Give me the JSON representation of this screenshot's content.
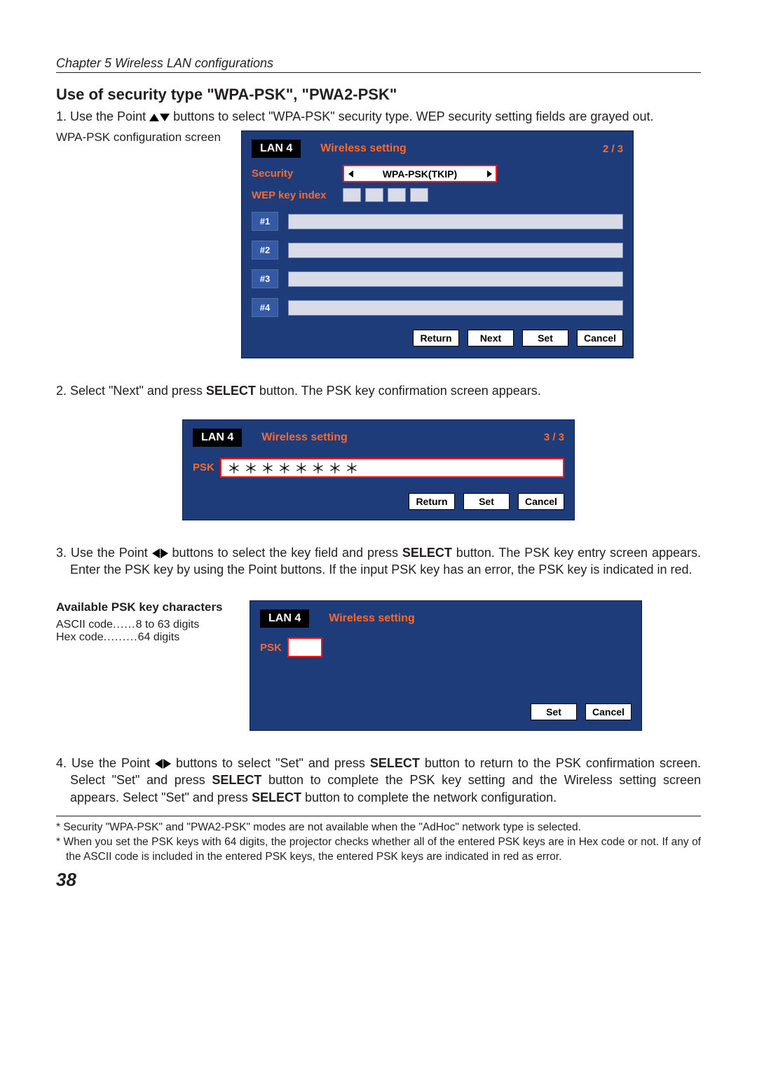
{
  "chapter": "Chapter 5 Wireless LAN configurations",
  "section_title": "Use of security type \"WPA-PSK\", \"PWA2-PSK\"",
  "step1_a": "1. Use the Point ",
  "step1_b": " buttons to select \"WPA-PSK\" security type. WEP security setting fields are grayed out.",
  "caption1": "WPA-PSK configuration screen",
  "screen1": {
    "lan": "LAN 4",
    "title": "Wireless setting",
    "page": "2 / 3",
    "security_label": "Security",
    "security_value": "WPA-PSK(TKIP)",
    "wep_label": "WEP key index",
    "keys": [
      "#1",
      "#2",
      "#3",
      "#4"
    ],
    "btn_return": "Return",
    "btn_next": "Next",
    "btn_set": "Set",
    "btn_cancel": "Cancel"
  },
  "step2_a": "2. Select \"Next\" and press ",
  "step2_select": "SELECT",
  "step2_b": " button. The PSK key confirmation screen appears.",
  "screen2": {
    "lan": "LAN 4",
    "title": "Wireless setting",
    "page": "3 / 3",
    "psk_label": "PSK",
    "psk_value": "＊＊＊＊＊＊＊＊",
    "btn_return": "Return",
    "btn_set": "Set",
    "btn_cancel": "Cancel"
  },
  "step3_a": "3. Use the Point ",
  "step3_b": " buttons to select the key field and press ",
  "step3_select": "SELECT",
  "step3_c": " button. The PSK key entry screen appears. Enter the PSK key by using the Point buttons. If the input PSK key has an error, the PSK key is indicated in red.",
  "available": {
    "title": "Available PSK key characters",
    "ascii_label": "ASCII code",
    "ascii_dots": "......",
    "ascii_value": "8 to 63 digits",
    "hex_label": "Hex code",
    "hex_dots": ".........",
    "hex_value": "64 digits"
  },
  "screen3": {
    "lan": "LAN 4",
    "title": "Wireless setting",
    "psk_label": "PSK",
    "btn_set": "Set",
    "btn_cancel": "Cancel"
  },
  "step4_a": "4. Use the Point ",
  "step4_b": " buttons to select \"Set\" and press ",
  "step4_select1": "SELECT",
  "step4_c": " button to return to the PSK confirmation screen. Select \"Set\"  and press ",
  "step4_select2": "SELECT",
  "step4_d": " button to complete the PSK key setting and the Wireless setting screen appears. Select \"Set\"  and press ",
  "step4_select3": "SELECT",
  "step4_e": " button to complete the network configuration.",
  "footnote1": "* Security \"WPA-PSK\" and \"PWA2-PSK\" modes are not available when the \"AdHoc\" network type is selected.",
  "footnote2": "* When you set the PSK keys with 64 digits, the projector checks whether all of the entered PSK keys are in Hex code or not. If any of the ASCII code is included in the entered PSK keys, the entered PSK keys are indicated in red as error.",
  "page_number": "38"
}
